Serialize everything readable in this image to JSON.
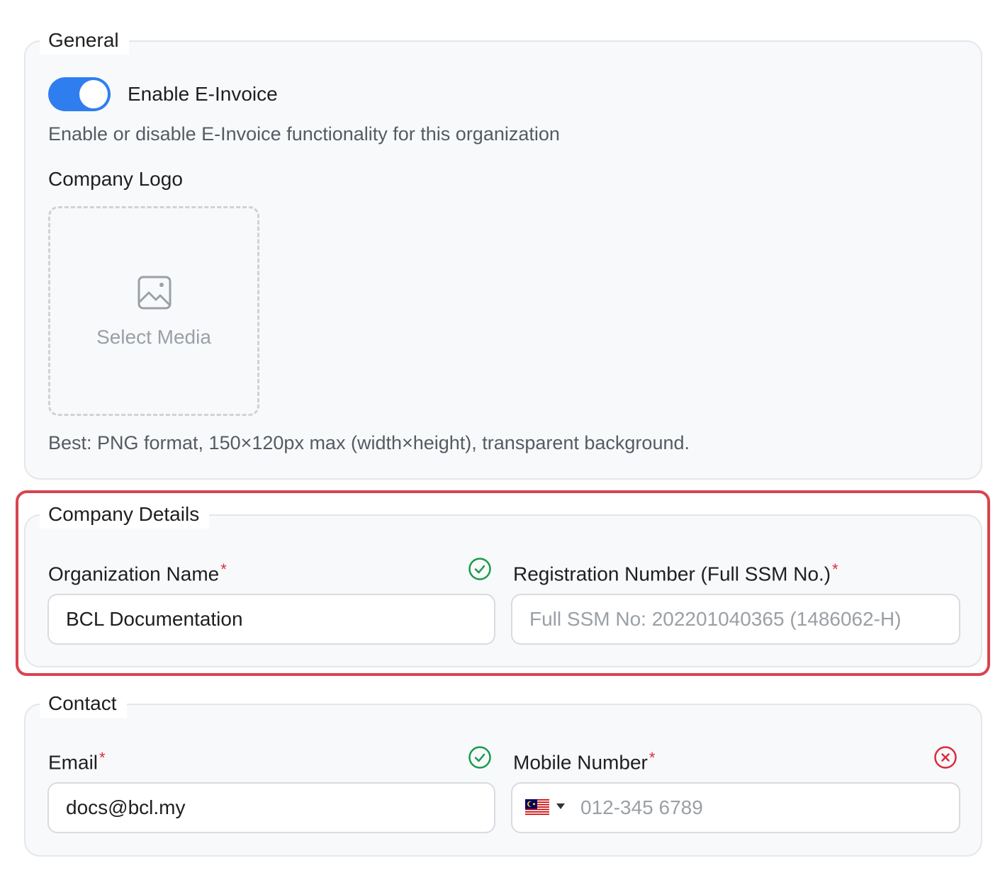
{
  "general": {
    "legend": "General",
    "toggle_label": "Enable E-Invoice",
    "toggle_state": "on",
    "toggle_description": "Enable or disable E-Invoice functionality for this organization",
    "logo_label": "Company Logo",
    "logo_dropzone_text": "Select Media",
    "logo_hint": "Best: PNG format, 150×120px max (width×height), transparent background."
  },
  "company": {
    "legend": "Company Details",
    "org_name_label": "Organization Name",
    "org_name_value": "BCL Documentation",
    "org_name_status": "valid",
    "reg_label": "Registration Number (Full SSM No.)",
    "reg_placeholder": "Full SSM No: 202201040365 (1486062-H)"
  },
  "contact": {
    "legend": "Contact",
    "email_label": "Email",
    "email_value": "docs@bcl.my",
    "email_status": "valid",
    "mobile_label": "Mobile Number",
    "mobile_placeholder": "012-345 6789",
    "mobile_status": "invalid",
    "country_flag": "malaysia-flag-icon"
  },
  "required_mark": "*",
  "colors": {
    "accent": "#2f7ef0",
    "valid": "#1a9b4b",
    "invalid": "#d92d3a",
    "highlight": "#d8444f"
  }
}
